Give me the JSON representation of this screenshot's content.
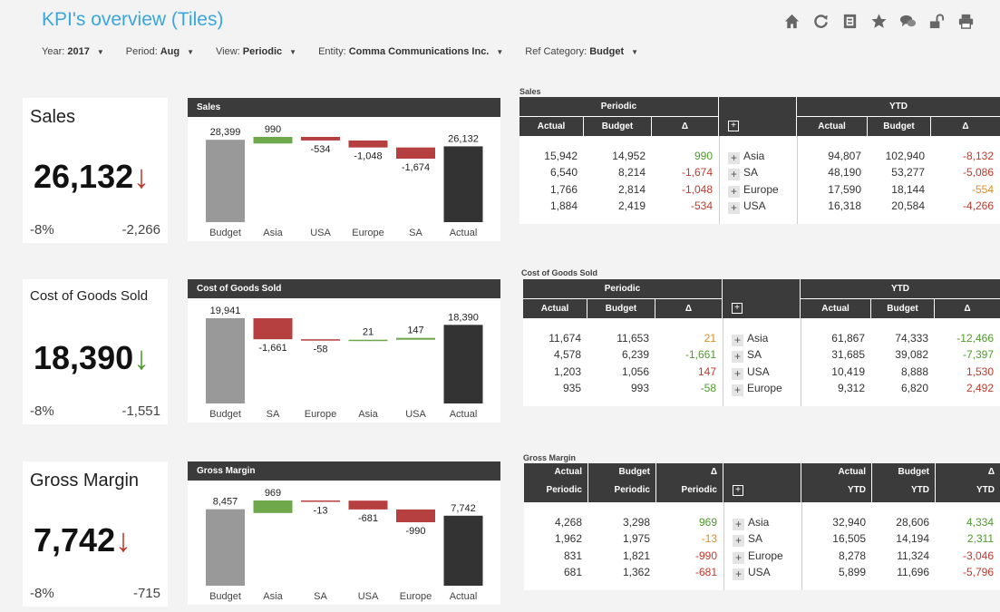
{
  "page_title": "KPI's overview (Tiles)",
  "filters": [
    {
      "label": "Year:",
      "value": "2017"
    },
    {
      "label": "Period:",
      "value": "Aug"
    },
    {
      "label": "View:",
      "value": "Periodic"
    },
    {
      "label": "Entity:",
      "value": "Comma Communications Inc."
    },
    {
      "label": "Ref Category:",
      "value": "Budget"
    }
  ],
  "toolbar_icons": [
    "home-icon",
    "refresh-icon",
    "sheet-icon",
    "star-icon",
    "comments-icon",
    "unlock-icon",
    "print-icon"
  ],
  "colors": {
    "accent": "#3aa6dc",
    "header": "#3b3b3b",
    "positive": "#4e9a2c",
    "negative": "#c0392b",
    "warning": "#e08a1c",
    "budget_bar": "#999999",
    "actual_bar": "#333333"
  },
  "sections": [
    {
      "kpi": {
        "title": "Sales",
        "value": "26,132",
        "arrow": "↓",
        "arrow_status": "negative",
        "pct": "-8%",
        "delta": "-2,266"
      },
      "waterfall": {
        "title": "Sales",
        "bars": [
          {
            "label": "Budget",
            "value": 28399,
            "text": "28,399",
            "kind": "total"
          },
          {
            "label": "Asia",
            "value": 990,
            "text": "990",
            "kind": "delta"
          },
          {
            "label": "USA",
            "value": -534,
            "text": "-534",
            "kind": "delta"
          },
          {
            "label": "Europe",
            "value": -1048,
            "text": "-1,048",
            "kind": "delta"
          },
          {
            "label": "SA",
            "value": -1674,
            "text": "-1,674",
            "kind": "delta"
          },
          {
            "label": "Actual",
            "value": 26132,
            "text": "26,132",
            "kind": "total"
          }
        ]
      },
      "table": {
        "title": "Sales",
        "header_style": "grouped",
        "periodic_label": "Periodic",
        "ytd_label": "YTD",
        "col_labels": [
          "Actual",
          "Budget",
          "Δ",
          "Actual",
          "Budget",
          "Δ"
        ],
        "rows": [
          {
            "p_act": "15,942",
            "p_bud": "14,952",
            "p_delta": "990",
            "p_status": "positive",
            "cat": "Asia",
            "y_act": "94,807",
            "y_bud": "102,940",
            "y_delta": "-8,132",
            "y_status": "negative"
          },
          {
            "p_act": "6,540",
            "p_bud": "8,214",
            "p_delta": "-1,674",
            "p_status": "negative",
            "cat": "SA",
            "y_act": "48,190",
            "y_bud": "53,277",
            "y_delta": "-5,086",
            "y_status": "negative"
          },
          {
            "p_act": "1,766",
            "p_bud": "2,814",
            "p_delta": "-1,048",
            "p_status": "negative",
            "cat": "Europe",
            "y_act": "17,590",
            "y_bud": "18,144",
            "y_delta": "-554",
            "y_status": "warning"
          },
          {
            "p_act": "1,884",
            "p_bud": "2,419",
            "p_delta": "-534",
            "p_status": "negative",
            "cat": "USA",
            "y_act": "16,318",
            "y_bud": "20,584",
            "y_delta": "-4,266",
            "y_status": "negative"
          }
        ]
      }
    },
    {
      "kpi": {
        "title": "Cost of Goods Sold",
        "value": "18,390",
        "arrow": "↓",
        "arrow_status": "positive",
        "pct": "-8%",
        "delta": "-1,551"
      },
      "waterfall": {
        "title": "Cost of Goods Sold",
        "bars": [
          {
            "label": "Budget",
            "value": 19941,
            "text": "19,941",
            "kind": "total"
          },
          {
            "label": "SA",
            "value": -1661,
            "text": "-1,661",
            "kind": "delta"
          },
          {
            "label": "Europe",
            "value": -58,
            "text": "-58",
            "kind": "delta"
          },
          {
            "label": "Asia",
            "value": 21,
            "text": "21",
            "kind": "delta"
          },
          {
            "label": "USA",
            "value": 147,
            "text": "147",
            "kind": "delta"
          },
          {
            "label": "Actual",
            "value": 18390,
            "text": "18,390",
            "kind": "total"
          }
        ]
      },
      "table": {
        "title": "Cost of Goods Sold",
        "header_style": "grouped",
        "periodic_label": "Periodic",
        "ytd_label": "YTD",
        "col_labels": [
          "Actual",
          "Budget",
          "Δ",
          "Actual",
          "Budget",
          "Δ"
        ],
        "rows": [
          {
            "p_act": "11,674",
            "p_bud": "11,653",
            "p_delta": "21",
            "p_status": "warning",
            "cat": "Asia",
            "y_act": "61,867",
            "y_bud": "74,333",
            "y_delta": "-12,466",
            "y_status": "positive"
          },
          {
            "p_act": "4,578",
            "p_bud": "6,239",
            "p_delta": "-1,661",
            "p_status": "positive",
            "cat": "SA",
            "y_act": "31,685",
            "y_bud": "39,082",
            "y_delta": "-7,397",
            "y_status": "positive"
          },
          {
            "p_act": "1,203",
            "p_bud": "1,056",
            "p_delta": "147",
            "p_status": "negative",
            "cat": "USA",
            "y_act": "10,419",
            "y_bud": "8,888",
            "y_delta": "1,530",
            "y_status": "negative"
          },
          {
            "p_act": "935",
            "p_bud": "993",
            "p_delta": "-58",
            "p_status": "positive",
            "cat": "Europe",
            "y_act": "9,312",
            "y_bud": "6,820",
            "y_delta": "2,492",
            "y_status": "negative"
          }
        ]
      }
    },
    {
      "kpi": {
        "title": "Gross Margin",
        "value": "7,742",
        "arrow": "↓",
        "arrow_status": "negative",
        "pct": "-8%",
        "delta": "-715"
      },
      "waterfall": {
        "title": "Gross Margin",
        "bars": [
          {
            "label": "Budget",
            "value": 8457,
            "text": "8,457",
            "kind": "total"
          },
          {
            "label": "Asia",
            "value": 969,
            "text": "969",
            "kind": "delta"
          },
          {
            "label": "SA",
            "value": -13,
            "text": "-13",
            "kind": "delta"
          },
          {
            "label": "USA",
            "value": -681,
            "text": "-681",
            "kind": "delta"
          },
          {
            "label": "Europe",
            "value": -990,
            "text": "-990",
            "kind": "delta"
          },
          {
            "label": "Actual",
            "value": 7742,
            "text": "7,742",
            "kind": "total"
          }
        ]
      },
      "table": {
        "title": "Gross Margin",
        "header_style": "two-line",
        "col_labels": [
          "Actual",
          "Budget",
          "Δ",
          "Actual",
          "Budget",
          "Δ"
        ],
        "col_sublabels": [
          "Periodic",
          "Periodic",
          "Periodic",
          "YTD",
          "YTD",
          "YTD"
        ],
        "rows": [
          {
            "p_act": "4,268",
            "p_bud": "3,298",
            "p_delta": "969",
            "p_status": "positive",
            "cat": "Asia",
            "y_act": "32,940",
            "y_bud": "28,606",
            "y_delta": "4,334",
            "y_status": "positive"
          },
          {
            "p_act": "1,962",
            "p_bud": "1,975",
            "p_delta": "-13",
            "p_status": "warning",
            "cat": "SA",
            "y_act": "16,505",
            "y_bud": "14,194",
            "y_delta": "2,311",
            "y_status": "positive"
          },
          {
            "p_act": "831",
            "p_bud": "1,821",
            "p_delta": "-990",
            "p_status": "negative",
            "cat": "Europe",
            "y_act": "8,278",
            "y_bud": "11,324",
            "y_delta": "-3,046",
            "y_status": "negative"
          },
          {
            "p_act": "681",
            "p_bud": "1,362",
            "p_delta": "-681",
            "p_status": "negative",
            "cat": "USA",
            "y_act": "5,899",
            "y_bud": "11,696",
            "y_delta": "-5,796",
            "y_status": "negative"
          }
        ]
      }
    }
  ]
}
